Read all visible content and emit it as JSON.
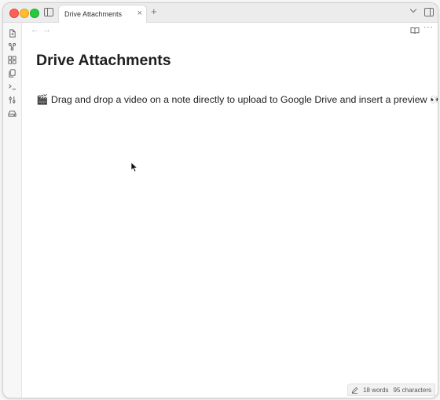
{
  "tab": {
    "title": "Drive Attachments",
    "close_glyph": "×",
    "new_tab_glyph": "+"
  },
  "nav": {
    "back_glyph": "←",
    "forward_glyph": "→",
    "more_glyph": "···"
  },
  "note": {
    "title": "Drive Attachments",
    "body": "🎬 Drag and drop a video on a note directly to upload to Google Drive and insert a preview 👀"
  },
  "status": {
    "words": "18 words",
    "characters": "95 characters"
  },
  "ribbon": {
    "icons": [
      "new-note-icon",
      "graph-view-icon",
      "canvas-icon",
      "templates-icon",
      "command-palette-icon",
      "settings-sliders-icon",
      "drive-icon"
    ]
  },
  "colors": {
    "close": "#ff5f57",
    "minimize": "#febc2e",
    "maximize": "#28c840"
  }
}
